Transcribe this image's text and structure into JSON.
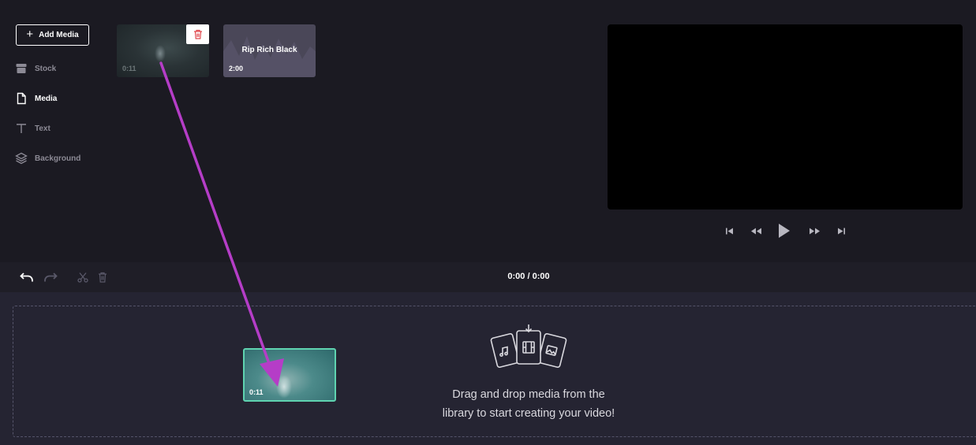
{
  "sidebar": {
    "add_media_label": "Add Media",
    "items": [
      {
        "label": "Stock",
        "icon": "store-icon"
      },
      {
        "label": "Media",
        "icon": "file-icon"
      },
      {
        "label": "Text",
        "icon": "text-icon"
      },
      {
        "label": "Background",
        "icon": "layers-icon"
      }
    ]
  },
  "library": {
    "tiles": [
      {
        "type": "video",
        "duration": "0:11"
      },
      {
        "type": "audio",
        "name": "Rip Rich Black",
        "duration": "2:00"
      }
    ]
  },
  "toolbar": {
    "time_display": "0:00 / 0:00"
  },
  "timeline": {
    "drop_text_line1": "Drag and drop media from the",
    "drop_text_line2": "library to start creating your video!",
    "clip_duration": "0:11"
  },
  "colors": {
    "background": "#1b1a22",
    "timeline_bg": "#252432",
    "clip_border": "#5fd3b0",
    "annotation_arrow": "#b53dc7",
    "delete_icon": "#e0484d"
  }
}
